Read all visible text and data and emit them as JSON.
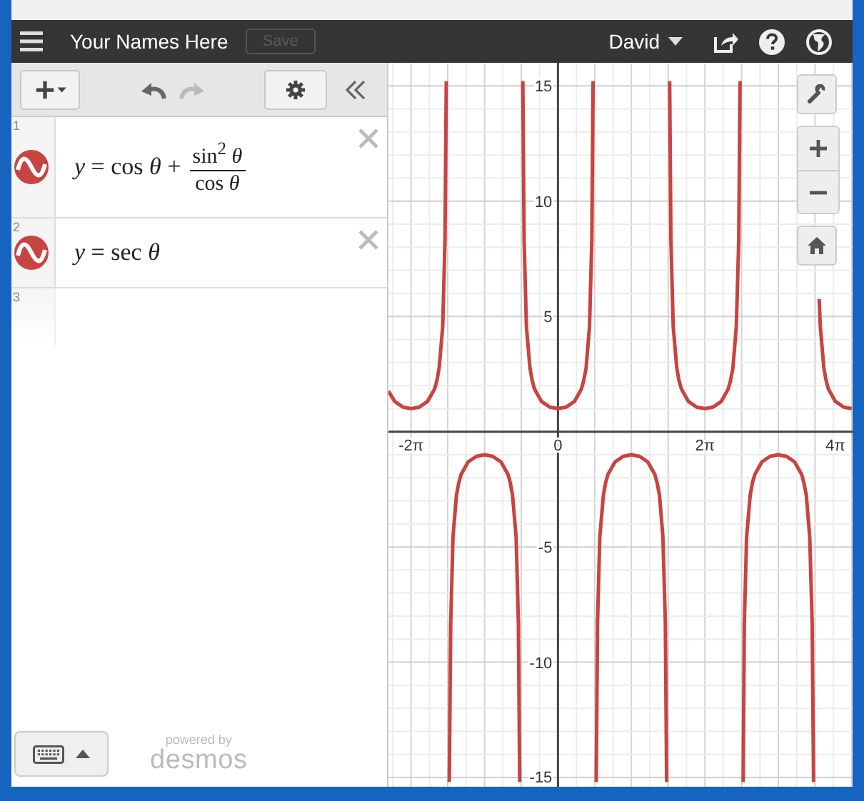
{
  "header": {
    "title": "Your Names Here",
    "save_button": {
      "label": "Save",
      "disabled": true
    },
    "user": "David"
  },
  "toolbar": {
    "undo_disabled": false,
    "redo_disabled": true
  },
  "expressions": [
    {
      "number": "1",
      "kind": "fraction",
      "color": "#c74440",
      "text": "*y* = cos *θ* +",
      "numerator": "sin$^{2}$ *θ*",
      "denominator": "cos *θ*"
    },
    {
      "number": "2",
      "kind": "plain",
      "color": "#c74440",
      "text": "*y* = sec *θ*"
    },
    {
      "number": "3",
      "kind": "empty"
    }
  ],
  "footer": {
    "powered_by": "powered by",
    "brand": "desmos"
  },
  "graph": {
    "chart_data": {
      "type": "line",
      "grid": true,
      "xlim": [
        -7.25,
        12.6
      ],
      "ylim": [
        -15.4,
        16
      ],
      "xticks": [
        {
          "value": -6.2832,
          "label": "-2π"
        },
        {
          "value": 0,
          "label": "0"
        },
        {
          "value": 6.2832,
          "label": "2π"
        },
        {
          "value": 12.5664,
          "label": "4π"
        }
      ],
      "yticks": [
        -15,
        -10,
        -5,
        5,
        10,
        15
      ],
      "x": [
        -7.25,
        -6.98,
        -6.63,
        -6.28,
        -5.93,
        -5.58,
        -5.28,
        -5.18,
        -5.08,
        -4.93,
        -4.83,
        -4.778,
        -4.646,
        -4.59,
        -4.49,
        -4.34,
        -4.24,
        -4.14,
        -3.84,
        -3.49,
        -3.14,
        -2.79,
        -2.44,
        -2.14,
        -2.04,
        -1.94,
        -1.79,
        -1.69,
        -1.637,
        -1.505,
        -1.45,
        -1.35,
        -1.2,
        -1.1,
        -1.0,
        -0.7,
        -0.35,
        0,
        0.35,
        0.7,
        1.0,
        1.1,
        1.2,
        1.35,
        1.45,
        1.505,
        1.637,
        1.69,
        1.79,
        1.94,
        2.04,
        2.14,
        2.44,
        2.79,
        3.14,
        3.49,
        3.84,
        4.14,
        4.24,
        4.34,
        4.49,
        4.59,
        4.646,
        4.778,
        4.83,
        4.93,
        5.08,
        5.18,
        5.28,
        5.58,
        5.93,
        6.28,
        6.63,
        6.98,
        7.28,
        7.38,
        7.48,
        7.63,
        7.73,
        7.788,
        7.92,
        7.97,
        8.07,
        8.22,
        8.32,
        8.42,
        8.72,
        9.07,
        9.42,
        9.77,
        10.12,
        10.42,
        10.52,
        10.62,
        10.77,
        10.87,
        10.93,
        11.17,
        11.22,
        11.37,
        11.47,
        11.57,
        11.87,
        12.22,
        12.57
      ],
      "series": [
        {
          "color": "#c74440",
          "values": [
            1.76,
            1.31,
            1.07,
            1,
            1.07,
            1.31,
            1.85,
            2.21,
            2.76,
            4.57,
            8.3,
            15.2,
            -15.2,
            -8.3,
            -4.57,
            -2.76,
            -2.21,
            -1.85,
            -1.31,
            -1.07,
            -1,
            -1.07,
            -1.31,
            -1.85,
            -2.21,
            -2.76,
            -4.57,
            -8.3,
            -15.2,
            15.2,
            8.3,
            4.57,
            2.76,
            2.21,
            1.85,
            1.31,
            1.07,
            1,
            1.07,
            1.31,
            1.85,
            2.21,
            2.76,
            4.57,
            8.3,
            15.2,
            -15.2,
            -8.3,
            -4.57,
            -2.76,
            -2.21,
            -1.85,
            -1.31,
            -1.07,
            -1,
            -1.07,
            -1.31,
            -1.85,
            -2.21,
            -2.76,
            -4.57,
            -8.3,
            -15.2,
            15.2,
            8.3,
            4.57,
            2.76,
            2.21,
            1.85,
            1.31,
            1.07,
            1,
            1.07,
            1.31,
            1.85,
            2.21,
            2.76,
            4.57,
            8.3,
            15.2,
            -15.2,
            -8.3,
            -4.57,
            -2.76,
            -2.21,
            -1.85,
            -1.31,
            -1.07,
            -1,
            -1.07,
            -1.31,
            -1.85,
            -2.21,
            -2.76,
            -4.57,
            -8.3,
            -15.2,
            5.75,
            4.57,
            2.76,
            2.21,
            1.85,
            1.31,
            1.07,
            1
          ]
        }
      ]
    }
  }
}
